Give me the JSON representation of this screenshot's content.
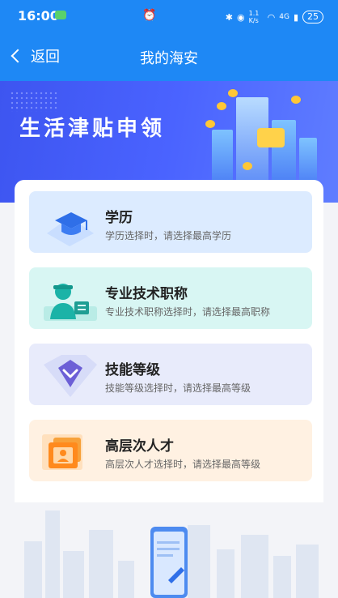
{
  "status_bar": {
    "time": "16:00",
    "network_speed": "1.1 K/s",
    "signal": "4G",
    "battery": "25"
  },
  "nav": {
    "back_label": "返回",
    "title": "我的海安"
  },
  "banner": {
    "title": "生活津贴申领"
  },
  "options": [
    {
      "title": "学历",
      "desc": "学历选择时，请选择最高学历",
      "icon": "graduation-cap-icon",
      "bg": "#dcebff"
    },
    {
      "title": "专业技术职称",
      "desc": "专业技术职称选择时，请选择最高职称",
      "icon": "professional-worker-icon",
      "bg": "#d8f6f3"
    },
    {
      "title": "技能等级",
      "desc": "技能等级选择时，请选择最高等级",
      "icon": "diamond-chevron-icon",
      "bg": "#e8ebfb"
    },
    {
      "title": "高层次人才",
      "desc": "高层次人才选择时，请选择最高等级",
      "icon": "certificate-icon",
      "bg": "#fff1e2"
    }
  ]
}
